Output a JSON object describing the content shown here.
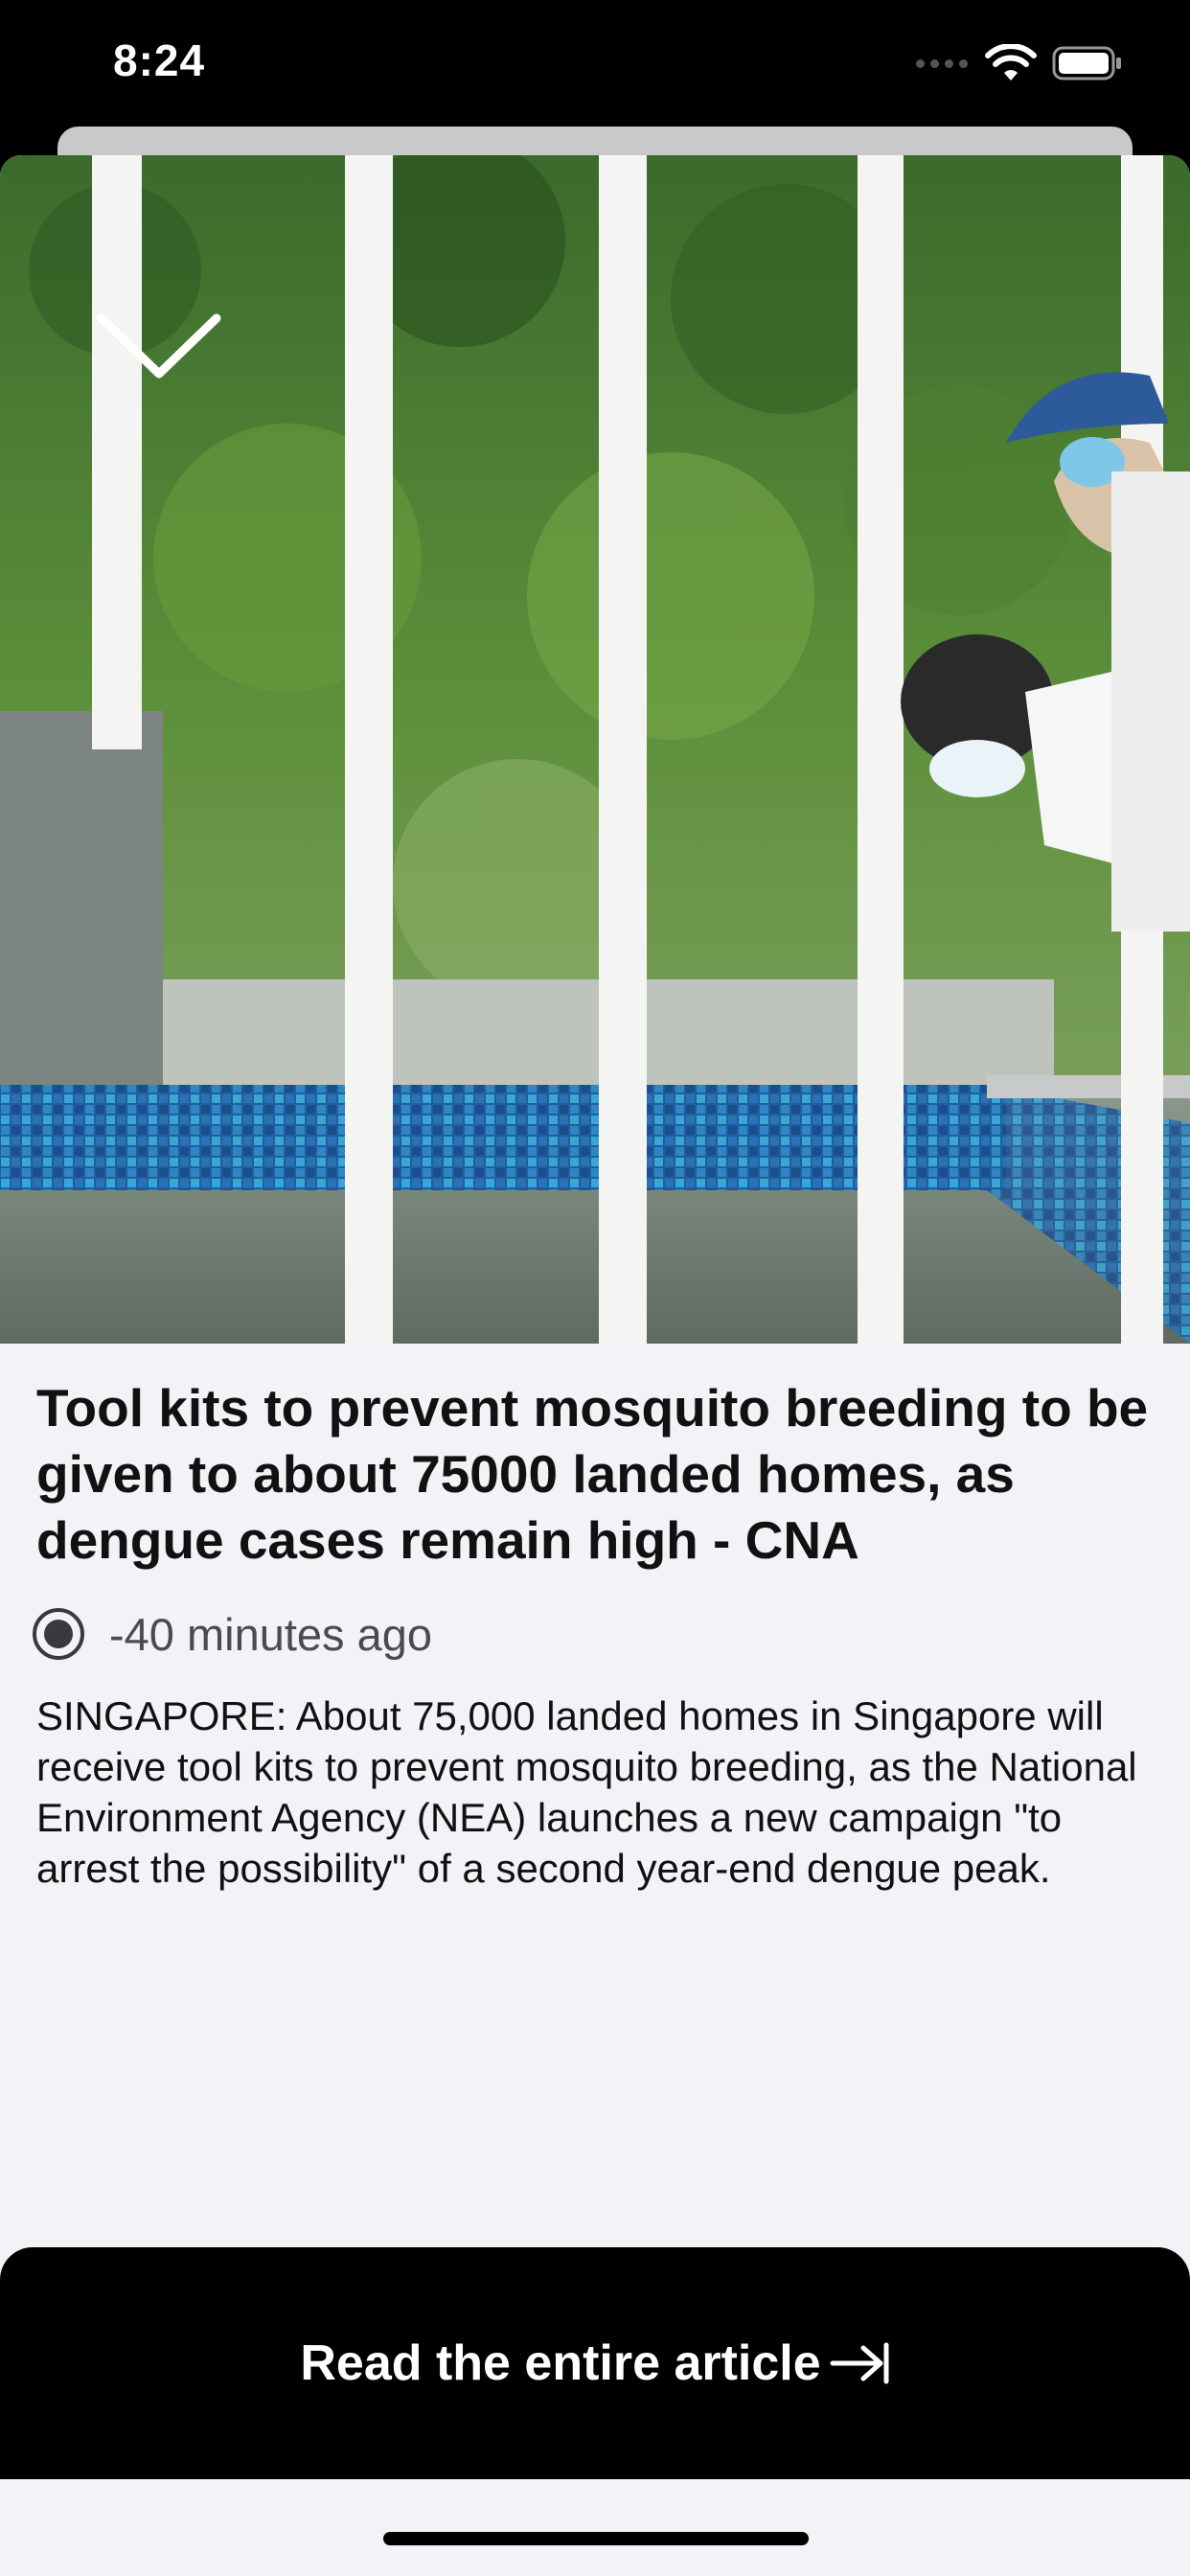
{
  "status_bar": {
    "time": "8:24"
  },
  "article": {
    "headline": "Tool kits to prevent mosquito breeding to be given to about 75000 landed homes, as dengue cases remain high - CNA",
    "time_ago": "-40 minutes ago",
    "summary": "SINGAPORE: About 75,000 landed homes in Singapore will receive tool kits to prevent mosquito breeding, as the National Environment Agency (NEA) launches a new campaign \"to arrest the possibility\" of a second year-end dengue peak."
  },
  "actions": {
    "read_entire_article": "Read the entire article"
  },
  "icons": {
    "collapse": "chevron-down-icon",
    "source": "radio-dot-icon",
    "open": "arrow-to-right-icon"
  }
}
